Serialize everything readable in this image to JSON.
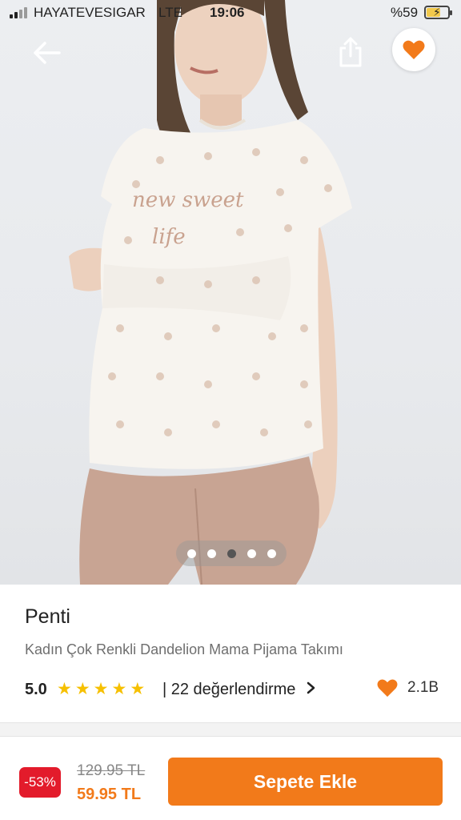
{
  "status_bar": {
    "carrier": "HAYATEVESIGAR",
    "network": "LTE",
    "time": "19:06",
    "battery": "%59"
  },
  "gallery": {
    "image_count": 5,
    "active_index": 2,
    "favorited": true,
    "accent": "#f27a1a"
  },
  "product": {
    "brand": "Penti",
    "name": "Kadın Çok Renkli Dandelion Mama Pijama Takımı",
    "rating": "5.0",
    "stars": 5,
    "reviews_label": "| 22 değerlendirme",
    "likes": "2.1B"
  },
  "bottom_bar": {
    "discount": "-53%",
    "old_price": "129.95 TL",
    "price": "59.95 TL",
    "add_to_cart": "Sepete Ekle"
  },
  "colors": {
    "primary": "#f27a1a",
    "discount_bg": "#e31b2b",
    "star": "#f6c000"
  },
  "icons": {
    "back": "arrow-left-icon",
    "share": "share-icon",
    "favorite": "heart-icon",
    "review_link": "chevron-right-icon",
    "likes": "heart-icon"
  }
}
